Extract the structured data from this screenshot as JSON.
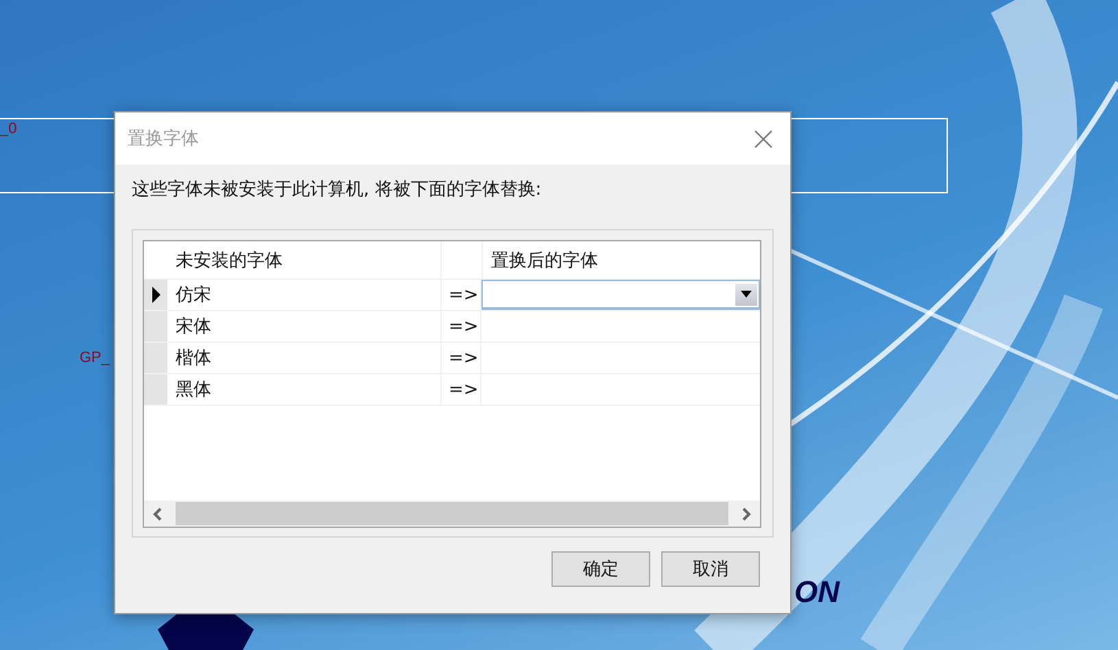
{
  "slide": {
    "labels": [
      {
        "text": "_0",
        "kind": "tag"
      },
      {
        "text": "GP_",
        "kind": "tag"
      },
      {
        "text": "ON",
        "kind": "logo"
      }
    ]
  },
  "dialog": {
    "title": "置换字体",
    "message": "这些字体未被安装于此计算机, 将被下面的字体替换:",
    "table": {
      "columns": [
        "未安装的字体",
        "置换后的字体"
      ],
      "rows": [
        {
          "missing": "仿宋",
          "arrow": "=>",
          "selected": true
        },
        {
          "missing": "宋体",
          "arrow": "=>",
          "selected": false
        },
        {
          "missing": "楷体",
          "arrow": "=>",
          "selected": false
        },
        {
          "missing": "黑体",
          "arrow": "=>",
          "selected": false
        }
      ]
    },
    "buttons": [
      "确定",
      "取消"
    ]
  }
}
